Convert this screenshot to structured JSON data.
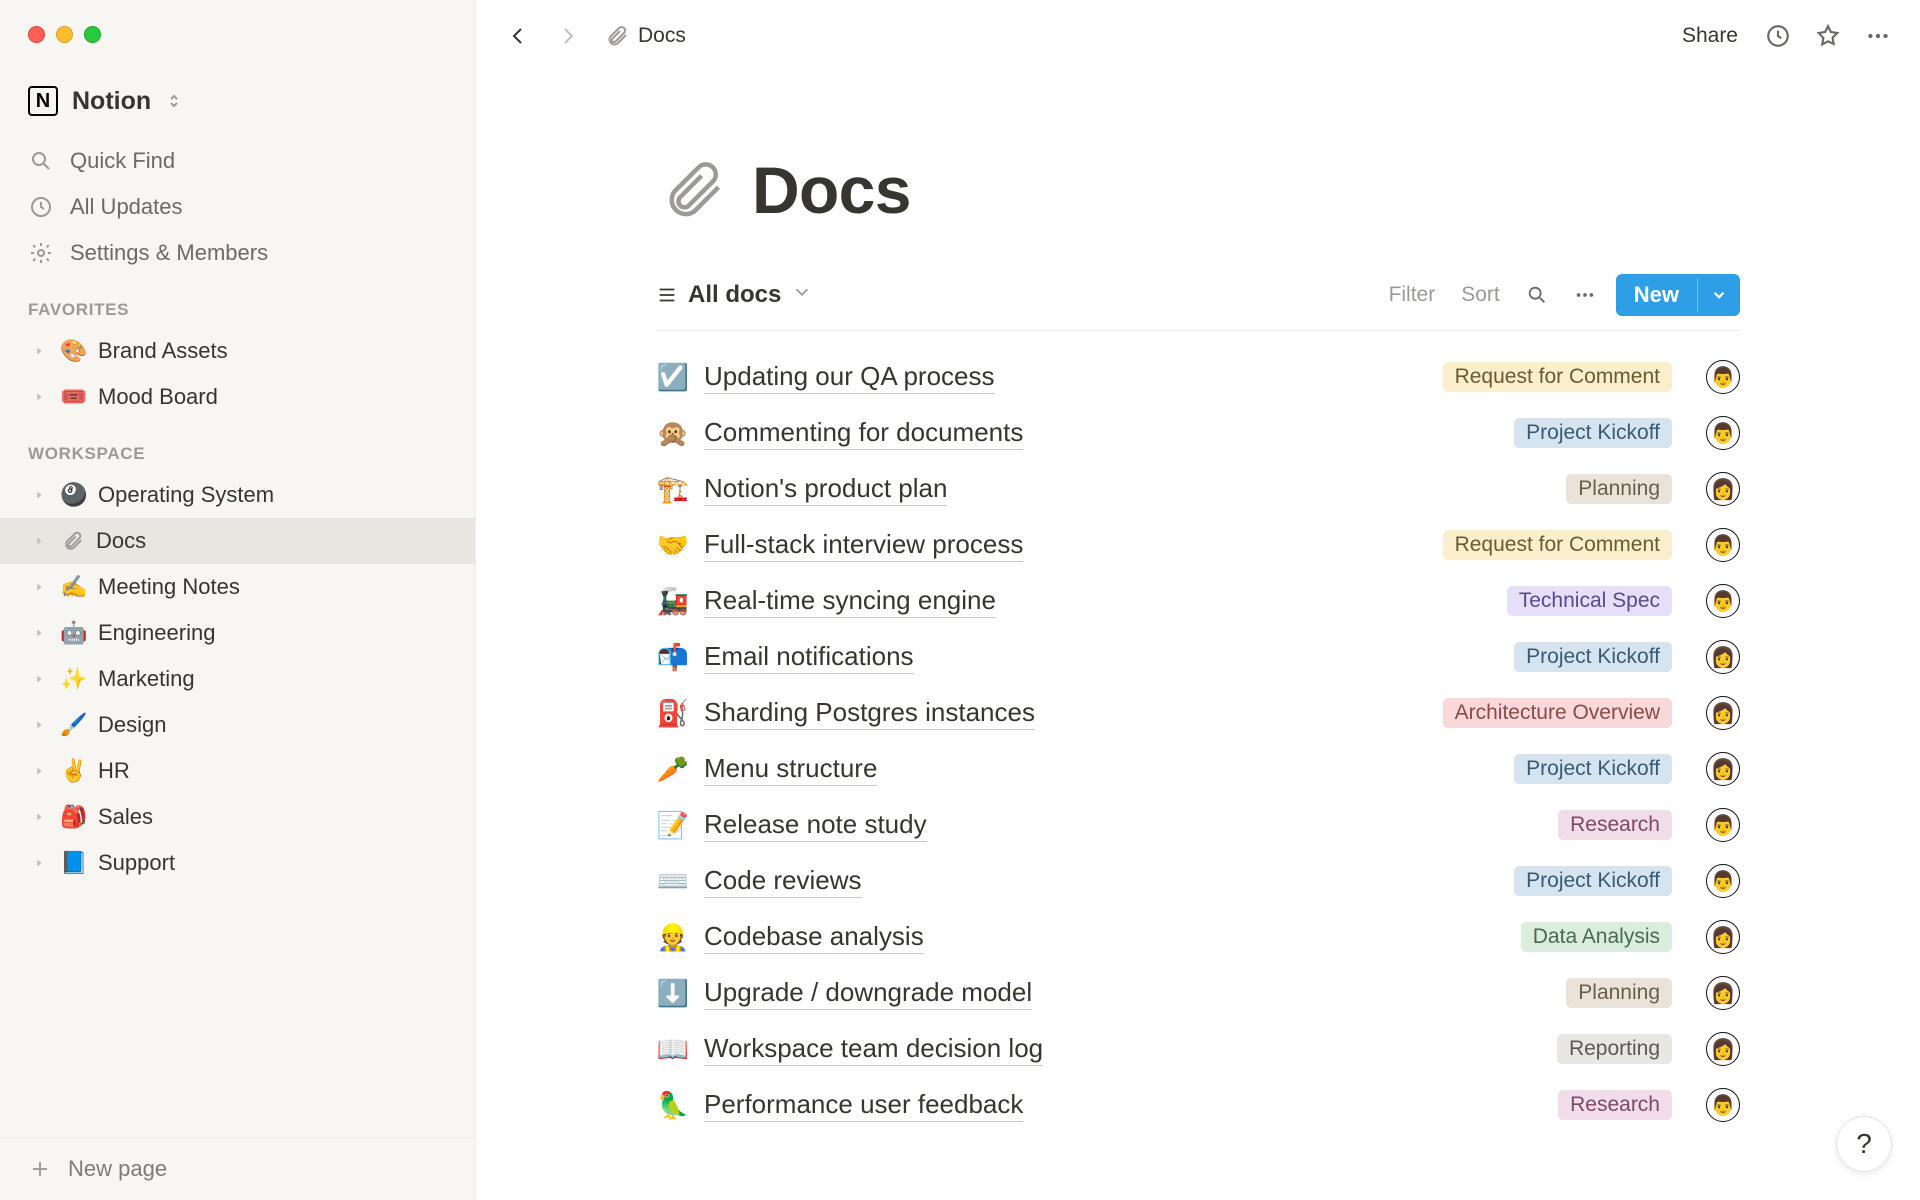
{
  "workspace": {
    "name": "Notion",
    "logo_letter": "N"
  },
  "sidebar": {
    "quick_find": "Quick Find",
    "all_updates": "All Updates",
    "settings_members": "Settings & Members",
    "favorites_label": "FAVORITES",
    "favorites": [
      {
        "emoji": "🎨",
        "label": "Brand Assets"
      },
      {
        "emoji": "🎟️",
        "label": "Mood Board"
      }
    ],
    "workspace_label": "WORKSPACE",
    "workspace_pages": [
      {
        "emoji": "🎱",
        "label": "Operating System",
        "selected": false,
        "is_docs_icon": false
      },
      {
        "emoji": "",
        "label": "Docs",
        "selected": true,
        "is_docs_icon": true
      },
      {
        "emoji": "✍️",
        "label": "Meeting Notes",
        "selected": false,
        "is_docs_icon": false
      },
      {
        "emoji": "🤖",
        "label": "Engineering",
        "selected": false,
        "is_docs_icon": false
      },
      {
        "emoji": "✨",
        "label": "Marketing",
        "selected": false,
        "is_docs_icon": false
      },
      {
        "emoji": "🖌️",
        "label": "Design",
        "selected": false,
        "is_docs_icon": false
      },
      {
        "emoji": "✌️",
        "label": "HR",
        "selected": false,
        "is_docs_icon": false
      },
      {
        "emoji": "🎒",
        "label": "Sales",
        "selected": false,
        "is_docs_icon": false
      },
      {
        "emoji": "📘",
        "label": "Support",
        "selected": false,
        "is_docs_icon": false
      }
    ],
    "new_page": "New page"
  },
  "topbar": {
    "breadcrumb": "Docs",
    "share": "Share"
  },
  "page": {
    "title": "Docs",
    "view_tab": "All docs",
    "filter": "Filter",
    "sort": "Sort",
    "new": "New"
  },
  "tag_labels": {
    "rfc": "Request for Comment",
    "kickoff": "Project Kickoff",
    "planning": "Planning",
    "techspec": "Technical Spec",
    "archover": "Architecture Overview",
    "research": "Research",
    "dataanalysis": "Data Analysis",
    "reporting": "Reporting"
  },
  "docs": [
    {
      "emoji": "☑️",
      "title": "Updating our QA process",
      "tag": "rfc",
      "avatar": "👨"
    },
    {
      "emoji": "🙊",
      "title": "Commenting for documents",
      "tag": "kickoff",
      "avatar": "👨"
    },
    {
      "emoji": "🏗️",
      "title": "Notion's product plan",
      "tag": "planning",
      "avatar": "👩"
    },
    {
      "emoji": "🤝",
      "title": "Full-stack interview process",
      "tag": "rfc",
      "avatar": "👨"
    },
    {
      "emoji": "🚂",
      "title": "Real-time syncing engine",
      "tag": "techspec",
      "avatar": "👨"
    },
    {
      "emoji": "📬",
      "title": "Email notifications",
      "tag": "kickoff",
      "avatar": "👩"
    },
    {
      "emoji": "⛽",
      "title": "Sharding Postgres instances",
      "tag": "archover",
      "avatar": "👩"
    },
    {
      "emoji": "🥕",
      "title": "Menu structure",
      "tag": "kickoff",
      "avatar": "👩"
    },
    {
      "emoji": "📝",
      "title": "Release note study",
      "tag": "research",
      "avatar": "👨"
    },
    {
      "emoji": "⌨️",
      "title": "Code reviews",
      "tag": "kickoff",
      "avatar": "👨"
    },
    {
      "emoji": "👷",
      "title": "Codebase analysis",
      "tag": "dataanalysis",
      "avatar": "👩"
    },
    {
      "emoji": "⬇️",
      "title": "Upgrade / downgrade model",
      "tag": "planning",
      "avatar": "👩"
    },
    {
      "emoji": "📖",
      "title": "Workspace team decision log",
      "tag": "reporting",
      "avatar": "👩"
    },
    {
      "emoji": "🦜",
      "title": "Performance user feedback",
      "tag": "research",
      "avatar": "👨"
    }
  ],
  "help": "?"
}
